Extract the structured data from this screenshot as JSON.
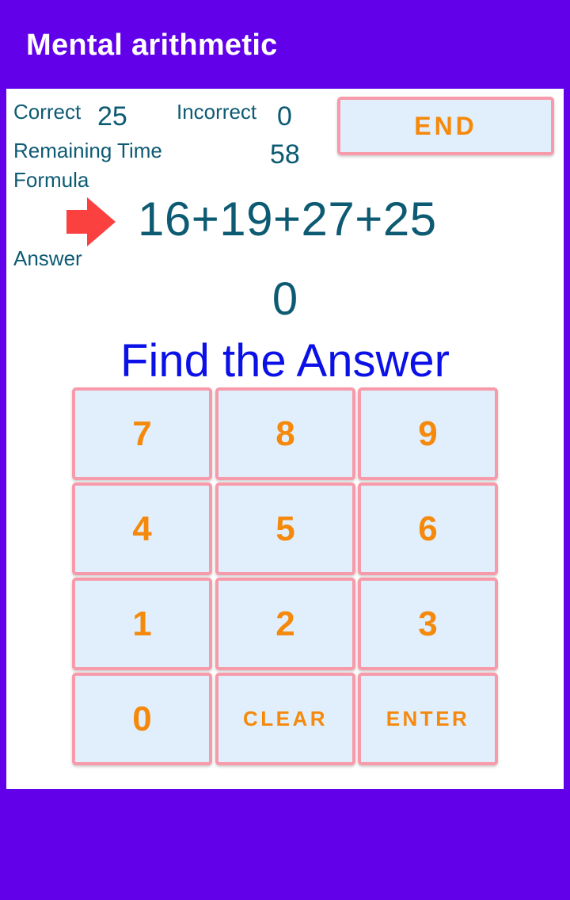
{
  "appbar": {
    "title": "Mental arithmetic"
  },
  "colors": {
    "primary": "#6200EA",
    "text": "#0d5a73",
    "prompt": "#0a10e6",
    "button_bg": "#e1effc",
    "button_border": "#f79aa9",
    "button_text": "#f5890c",
    "arrow": "#fb4040"
  },
  "stats": {
    "correct_label": "Correct",
    "correct_value": "25",
    "incorrect_label": "Incorrect",
    "incorrect_value": "0",
    "remaining_label": "Remaining Time",
    "remaining_value": "58"
  },
  "end_button": {
    "label": "END"
  },
  "formula": {
    "label": "Formula",
    "icon": "arrow-right-icon",
    "value": "16+19+27+25"
  },
  "answer": {
    "label": "Answer",
    "value": "0"
  },
  "prompt": "Find the Answer",
  "keypad": {
    "keys": [
      {
        "label": "7"
      },
      {
        "label": "8"
      },
      {
        "label": "9"
      },
      {
        "label": "4"
      },
      {
        "label": "5"
      },
      {
        "label": "6"
      },
      {
        "label": "1"
      },
      {
        "label": "2"
      },
      {
        "label": "3"
      },
      {
        "label": "0"
      },
      {
        "label": "CLEAR"
      },
      {
        "label": "ENTER"
      }
    ]
  }
}
